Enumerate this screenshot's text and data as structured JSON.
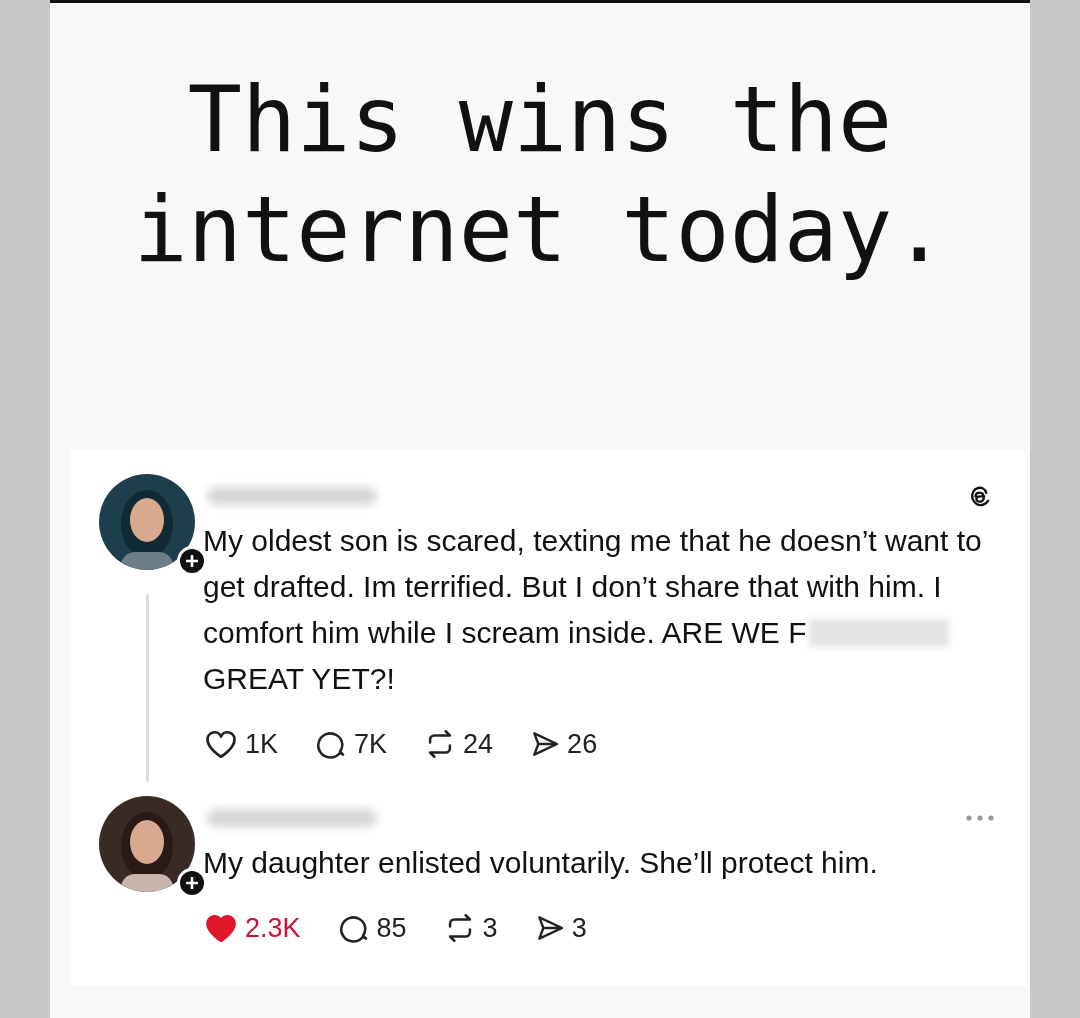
{
  "headline": [
    "This wins the",
    "internet today."
  ],
  "posts": [
    {
      "corner": {
        "kind": "threads"
      },
      "thread_line": true,
      "text": "My oldest son is scared, texting me that he doesn’t want to get drafted. Im terrified. But I don’t share that with him. I comfort him while I scream inside. ARE WE F",
      "redacted": true,
      "text_after": "GREAT YET?!",
      "liked": false,
      "likes": "1K",
      "replies": "7K",
      "reposts": "24",
      "shares": "26"
    },
    {
      "corner": {
        "kind": "more"
      },
      "thread_line": false,
      "text": "My daughter enlisted voluntarily. She’ll protect him.",
      "redacted": false,
      "liked": true,
      "likes": "2.3K",
      "replies": "85",
      "reposts": "3",
      "shares": "3"
    }
  ]
}
